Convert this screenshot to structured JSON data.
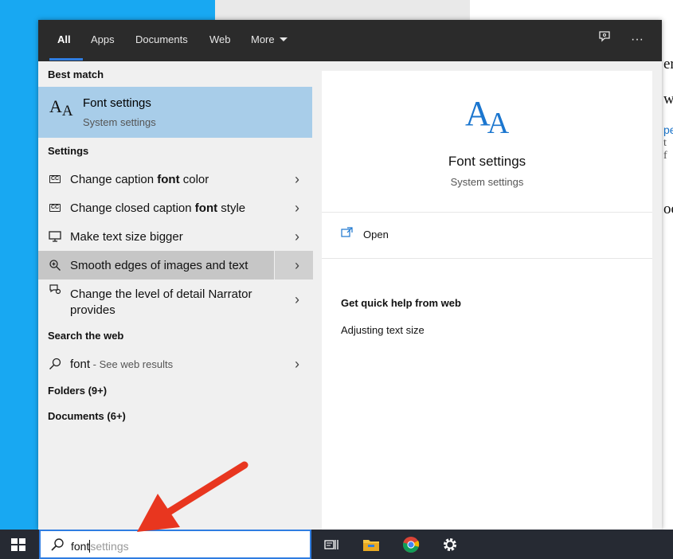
{
  "background": {
    "doc_fragments": [
      "er",
      "w",
      "pe",
      "t f",
      "oo"
    ]
  },
  "topbar": {
    "tabs": [
      {
        "label": "All",
        "active": true
      },
      {
        "label": "Apps"
      },
      {
        "label": "Documents"
      },
      {
        "label": "Web"
      },
      {
        "label": "More"
      }
    ],
    "icons": [
      "feedback-icon",
      "more-options-icon"
    ],
    "more_glyph": "···"
  },
  "left": {
    "best_match_header": "Best match",
    "best_match": {
      "title": "Font settings",
      "subtitle": "System settings",
      "icon": "font-aa-icon"
    },
    "settings_header": "Settings",
    "settings_items": [
      {
        "pre": "Change caption ",
        "bold": "font",
        "post": " color",
        "icon": "closed-caption-icon"
      },
      {
        "pre": "Change closed caption ",
        "bold": "font",
        "post": " style",
        "icon": "closed-caption-icon"
      },
      {
        "pre": "Make text size bigger",
        "bold": "",
        "post": "",
        "icon": "monitor-icon"
      },
      {
        "pre": "Smooth edges of images and text",
        "bold": "",
        "post": "",
        "icon": "magnifier-icon",
        "highlighted": true
      },
      {
        "pre": "Change the level of detail Narrator provides",
        "bold": "",
        "post": "",
        "icon": "narrator-icon"
      }
    ],
    "web_header": "Search the web",
    "web_item": {
      "query": "font",
      "suffix": " - See web results"
    },
    "folders": "Folders (9+)",
    "documents": "Documents (6+)"
  },
  "right": {
    "title": "Font settings",
    "subtitle": "System settings",
    "open_label": "Open",
    "quick_help_header": "Get quick help from web",
    "quick_help_items": [
      "Adjusting text size"
    ]
  },
  "taskbar": {
    "search_typed": "font",
    "search_suggestion": "settings",
    "icons": [
      "windows-start-icon",
      "task-view-icon",
      "file-explorer-icon",
      "chrome-icon",
      "settings-gear-icon"
    ]
  },
  "colors": {
    "accent": "#2f7de1",
    "selection": "#a8cde9",
    "icon_blue": "#1b76cf",
    "arrow": "#e8361f"
  }
}
